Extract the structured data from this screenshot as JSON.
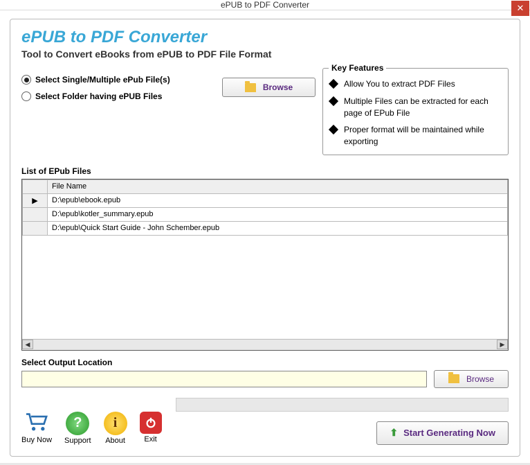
{
  "window": {
    "title": "ePUB to PDF Converter"
  },
  "header": {
    "title": "ePUB to PDF Converter",
    "subtitle": "Tool to Convert eBooks from ePUB to PDF File Format"
  },
  "select": {
    "option1": "Select Single/Multiple ePub File(s)",
    "option2": "Select Folder having ePUB Files",
    "selected": 0,
    "browse": "Browse"
  },
  "features": {
    "title": "Key Features",
    "items": [
      "Allow You to extract PDF Files",
      "Multiple Files can be extracted for each page of EPub File",
      "Proper format will be maintained while exporting"
    ]
  },
  "filelist": {
    "label": "List of EPub Files",
    "column": "File Name",
    "rows": [
      "D:\\epub\\ebook.epub",
      "D:\\epub\\kotler_summary.epub",
      "D:\\epub\\Quick Start Guide - John Schember.epub"
    ]
  },
  "output": {
    "label": "Select  Output Location",
    "value": "",
    "browse": "Browse"
  },
  "buttons": {
    "buynow": "Buy Now",
    "support": "Support",
    "about": "About",
    "exit": "Exit",
    "generate": "Start Generating Now"
  }
}
